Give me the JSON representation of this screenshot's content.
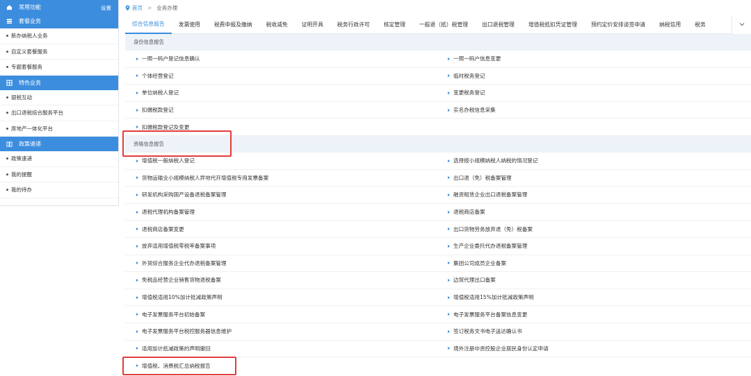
{
  "sidebar": {
    "common": {
      "label": "常用功能",
      "settings": "设置"
    },
    "group1": {
      "label": "套餐业务",
      "items": [
        "新办纳税人业务",
        "自定义套餐服务",
        "专题套餐服务"
      ]
    },
    "group2": {
      "label": "特色业务",
      "items": [
        "银税互动",
        "出口退税综合服务平台",
        "房地产一体化平台"
      ]
    },
    "group3": {
      "label": "政策速递",
      "items": [
        "政策速递",
        "我的提醒",
        "我的待办"
      ]
    }
  },
  "breadcrumb": {
    "home": "首页",
    "sep": ">",
    "current": "业务办理"
  },
  "tabs": [
    "综合信息报告",
    "发票使用",
    "税费申报及缴纳",
    "税收减免",
    "证明开具",
    "税务行政许可",
    "核定管理",
    "一般退（抵）税管理",
    "出口退税管理",
    "增值税抵扣凭证管理",
    "预约定价安排谈签申请",
    "纳税信用",
    "税务"
  ],
  "sections": [
    {
      "title": "身份信息报告",
      "rows": [
        [
          "一照一码户登记信息确认",
          "一照一码户信息变更"
        ],
        [
          "个体经营登记",
          "临时税务登记"
        ],
        [
          "单位纳税人登记",
          "变更税务登记"
        ],
        [
          "扣缴税款登记",
          "实名办税信息采集"
        ],
        [
          "扣缴税款登记及变更",
          ""
        ]
      ]
    },
    {
      "title": "资格信息报告",
      "rows": [
        [
          "增值税一般纳税人登记",
          "选择按小规模纳税人纳税的情况登记"
        ],
        [
          "货物运输业小规模纳税人异地代开增值税专用发票备案",
          "出口退（免）税备案管理"
        ],
        [
          "研发机构采购国产设备退税备案管理",
          "融资租赁企业出口退税备案管理"
        ],
        [
          "退税代理机构备案管理",
          "退税商店备案"
        ],
        [
          "退税商店备案变更",
          "出口货物劳务放弃退（免）税备案"
        ],
        [
          "放弃适用增值税零税率备案事项",
          "生产企业委托代办退税备案管理"
        ],
        [
          "外贸综合服务企业代办退税备案管理",
          "集团公司成员企业备案"
        ],
        [
          "免税品经营企业销售货物退税备案",
          "边贸代理出口备案"
        ],
        [
          "增值税适用10%加计抵减政策声明",
          "增值税适用15%加计抵减政策声明"
        ],
        [
          "电子发票服务平台初始备案",
          "电子发票服务平台备案信息变更"
        ],
        [
          "电子发票服务平台税控服务器信息维护",
          "签订税务文书电子送达确认书"
        ],
        [
          "适用加计抵减政策的声明撤回",
          "境外注册中资控股企业居民身份认定申请"
        ],
        [
          "增值税、消费税汇总纳税报告",
          ""
        ]
      ]
    }
  ]
}
